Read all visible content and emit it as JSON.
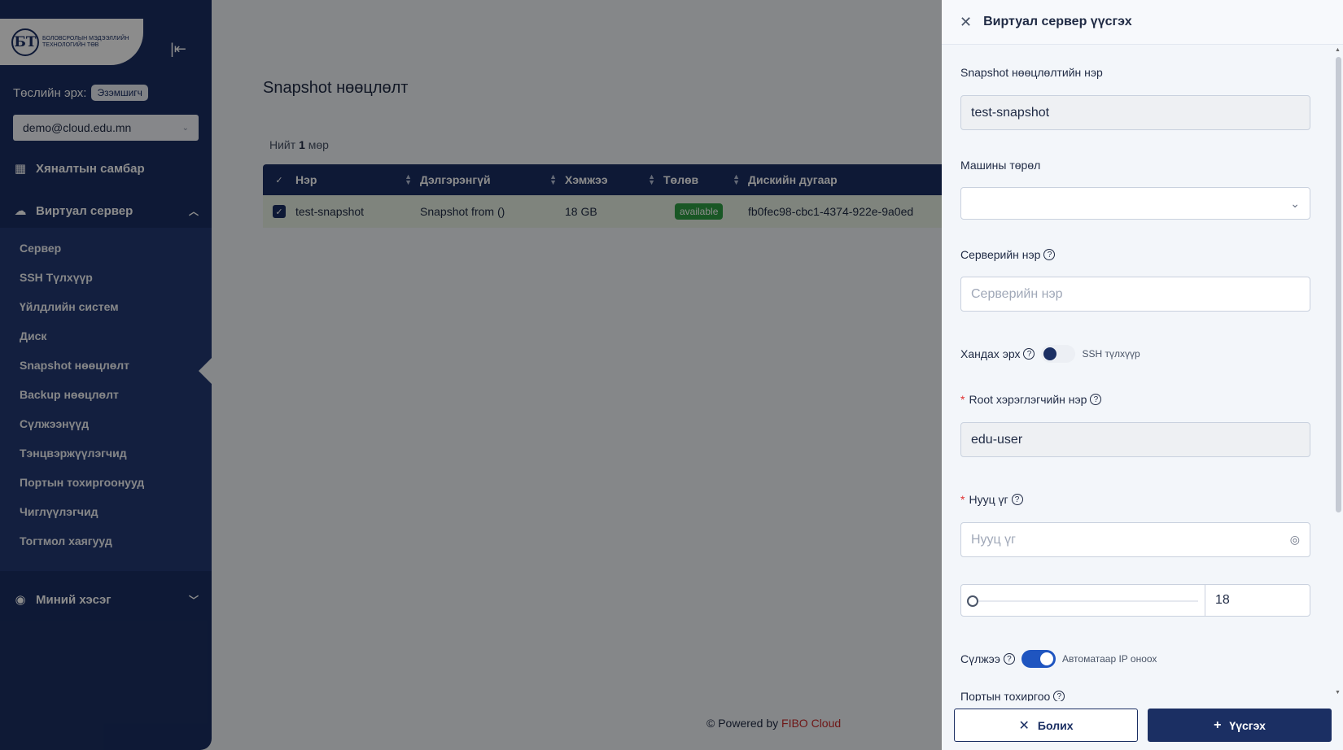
{
  "sidebar": {
    "logo_letters": "БТ",
    "logo_text": "Боловсролын мэдээллийн технологийн төв",
    "role_label": "Төслийн эрх:",
    "role_badge": "Эзэмшигч",
    "account": "demo@cloud.edu.mn",
    "dashboard": "Хяналтын самбар",
    "virtual_server": "Виртуал сервер",
    "sub_items": [
      "Сервер",
      "SSH Түлхүүр",
      "Үйлдлийн систем",
      "Диск",
      "Snapshot нөөцлөлт",
      "Backup нөөцлөлт",
      "Сүлжээнүүд",
      "Тэнцвэржүүлэгчид",
      "Портын тохиргоонууд",
      "Чиглүүлэгчид",
      "Тогтмол хаягууд"
    ],
    "my_section": "Миний хэсэг"
  },
  "main": {
    "page_title": "Snapshot нөөцлөлт",
    "total_prefix": "Нийт",
    "total_count": "1",
    "total_suffix": "мөр",
    "columns": [
      "Нэр",
      "Дэлгэрэнгүй",
      "Хэмжээ",
      "Төлөв",
      "Дискийн дугаар"
    ],
    "rows": [
      {
        "name": "test-snapshot",
        "details": "Snapshot from ()",
        "size": "18 GB",
        "status": "available",
        "disk_id": "fb0fec98-cbc1-4374-922e-9a0ed"
      }
    ],
    "footer_prefix": "© Powered by",
    "footer_brand": "FIBO Cloud"
  },
  "drawer": {
    "title": "Виртуал сервер үүсгэх",
    "snapshot_name_label": "Snapshot нөөцлөлтийн нэр",
    "snapshot_name_value": "test-snapshot",
    "machine_type_label": "Машины төрөл",
    "machine_type_value": "",
    "server_name_label": "Серверийн нэр",
    "server_name_placeholder": "Серверийн нэр",
    "access_label": "Хандах эрх",
    "access_toggle_text": "SSH түлхүүр",
    "access_toggle_on": false,
    "root_user_label": "Root хэрэглэгчийн нэр",
    "root_user_value": "edu-user",
    "password_label": "Нууц үг",
    "password_placeholder": "Нууц үг",
    "disk_size_value": "18",
    "network_label": "Сүлжээ",
    "network_toggle_text": "Автоматаар IP оноох",
    "network_toggle_on": true,
    "port_label": "Портын тохиргоо",
    "cancel_label": "Болих",
    "create_label": "Үүсгэх"
  },
  "colors": {
    "primary": "#1b2f63",
    "accent": "#1f55c0",
    "status_available": "#2f9e44",
    "brand_red": "#c92a2a"
  }
}
